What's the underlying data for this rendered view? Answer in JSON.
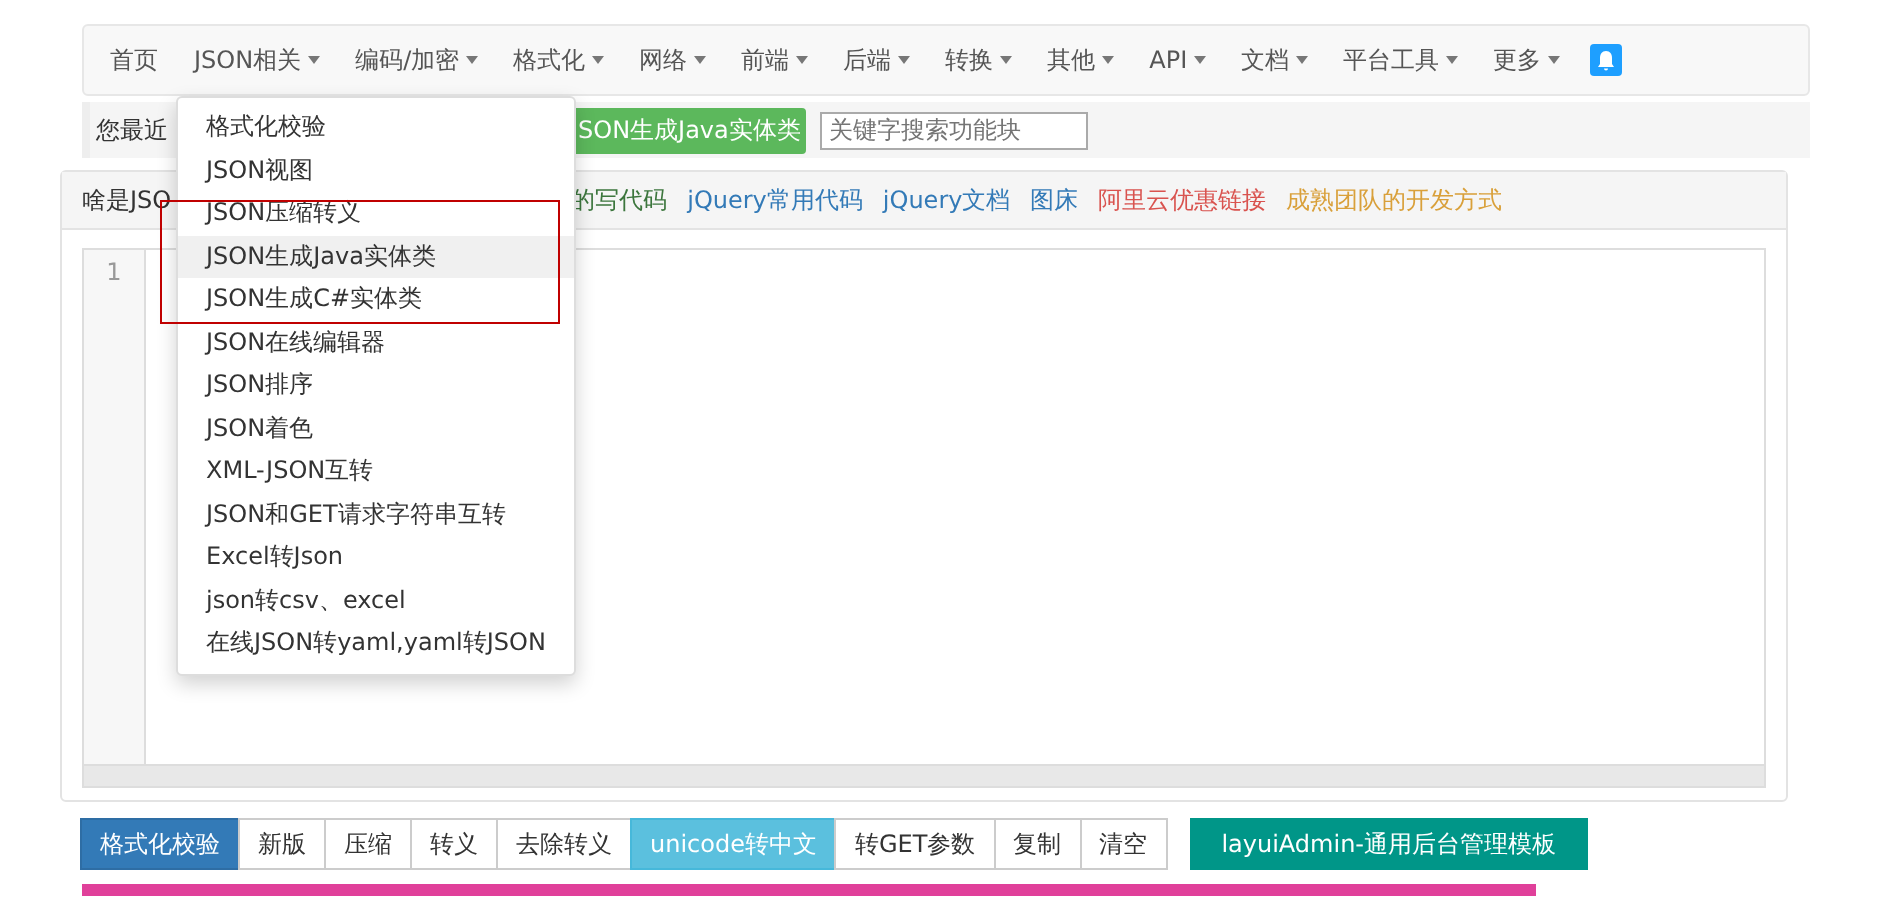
{
  "nav": {
    "items": [
      {
        "label": "首页",
        "has_menu": false
      },
      {
        "label": "JSON相关",
        "has_menu": true
      },
      {
        "label": "编码/加密",
        "has_menu": true
      },
      {
        "label": "格式化",
        "has_menu": true
      },
      {
        "label": "网络",
        "has_menu": true
      },
      {
        "label": "前端",
        "has_menu": true
      },
      {
        "label": "后端",
        "has_menu": true
      },
      {
        "label": "转换",
        "has_menu": true
      },
      {
        "label": "其他",
        "has_menu": true
      },
      {
        "label": "API",
        "has_menu": true
      },
      {
        "label": "文档",
        "has_menu": true
      },
      {
        "label": "平台工具",
        "has_menu": true
      },
      {
        "label": "更多",
        "has_menu": true
      }
    ]
  },
  "recent": {
    "label": "您最近",
    "shortcuts": [
      "SON生成Java实体类"
    ],
    "search": {
      "placeholder": "关键字搜索功能块"
    }
  },
  "links": [
    {
      "label": "啥是JSO",
      "color": "#333333"
    },
    {
      "label": "的写代码",
      "color": "#3c763d"
    },
    {
      "label": "jQuery常用代码",
      "color": "#337ab7"
    },
    {
      "label": "jQuery文档",
      "color": "#337ab7"
    },
    {
      "label": "图床",
      "color": "#337ab7"
    },
    {
      "label": "阿里云优惠链接",
      "color": "#d9534f"
    },
    {
      "label": "成熟团队的开发方式",
      "color": "#d9a03a"
    }
  ],
  "editor": {
    "line_numbers": [
      "1"
    ]
  },
  "toolbar": {
    "buttons": [
      {
        "label": "格式化校验",
        "kind": "primary"
      },
      {
        "label": "新版",
        "kind": "default"
      },
      {
        "label": "压缩",
        "kind": "default"
      },
      {
        "label": "转义",
        "kind": "default"
      },
      {
        "label": "去除转义",
        "kind": "default"
      },
      {
        "label": "unicode转中文",
        "kind": "info"
      },
      {
        "label": "转GET参数",
        "kind": "default"
      },
      {
        "label": "复制",
        "kind": "default"
      },
      {
        "label": "清空",
        "kind": "default"
      }
    ],
    "template_link": "layuiAdmin-通用后台管理模板"
  },
  "dropdown": {
    "items": [
      {
        "label": "格式化校验",
        "highlighted": false
      },
      {
        "label": "JSON视图",
        "highlighted": false
      },
      {
        "label": "JSON压缩转义",
        "highlighted": false
      },
      {
        "label": "JSON生成Java实体类",
        "highlighted": true
      },
      {
        "label": "JSON生成C#实体类",
        "highlighted": false
      },
      {
        "label": "JSON在线编辑器",
        "highlighted": false
      },
      {
        "label": "JSON排序",
        "highlighted": false
      },
      {
        "label": "JSON着色",
        "highlighted": false
      },
      {
        "label": "XML-JSON互转",
        "highlighted": false
      },
      {
        "label": "JSON和GET请求字符串互转",
        "highlighted": false
      },
      {
        "label": "Excel转Json",
        "highlighted": false
      },
      {
        "label": "json转csv、excel",
        "highlighted": false
      },
      {
        "label": "在线JSON转yaml,yaml转JSON",
        "highlighted": false
      }
    ]
  }
}
